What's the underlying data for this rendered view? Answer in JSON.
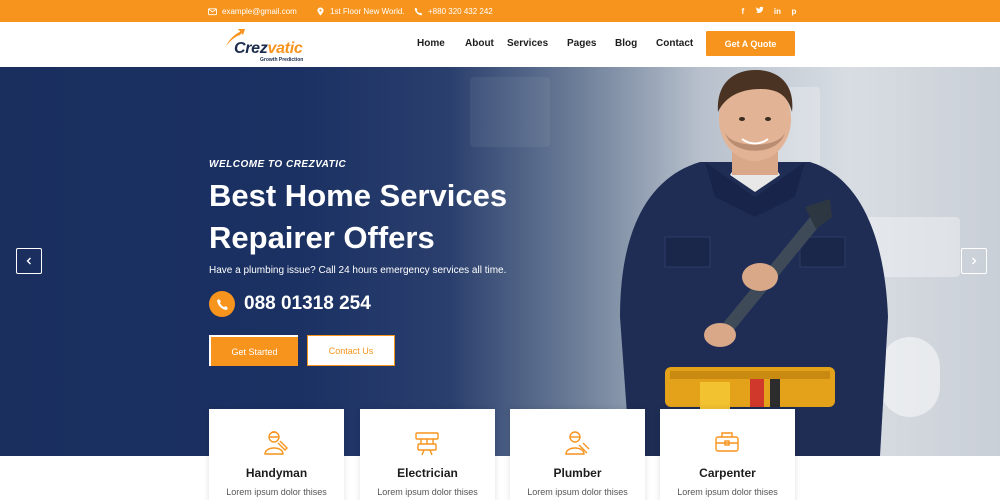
{
  "topbar": {
    "email": "example@gmail.com",
    "address": "1st Floor New World.",
    "phone": "+880 320 432 242",
    "social_icons": [
      "facebook-icon",
      "twitter-icon",
      "linkedin-icon",
      "pinterest-icon"
    ]
  },
  "brand": {
    "name_main": "Crez",
    "name_accent": "vatic",
    "tagline": "Growth Prediction"
  },
  "nav": {
    "items": [
      "Home",
      "About",
      "Services",
      "Pages",
      "Blog",
      "Contact"
    ],
    "quote_label": "Get A Quote"
  },
  "hero": {
    "welcome": "WELCOME TO CREZVATIC",
    "headline_line1": "Best Home Services",
    "headline_line2": "Repairer Offers",
    "subtext": "Have a plumbing issue? Call 24 hours emergency services all time.",
    "phone": "088 01318 254",
    "primary_button": "Get Started",
    "secondary_button": "Contact Us"
  },
  "services": [
    {
      "title": "Handyman",
      "text": "Lorem ipsum dolor thises",
      "icon": "handyman-icon"
    },
    {
      "title": "Electrician",
      "text": "Lorem ipsum dolor thises",
      "icon": "electrician-icon"
    },
    {
      "title": "Plumber",
      "text": "Lorem ipsum dolor thises",
      "icon": "plumber-icon"
    },
    {
      "title": "Carpenter",
      "text": "Lorem ipsum dolor thises",
      "icon": "carpenter-icon"
    }
  ],
  "colors": {
    "accent": "#f7941d",
    "navy": "#1a2f5e",
    "text": "#1d1d1d"
  }
}
